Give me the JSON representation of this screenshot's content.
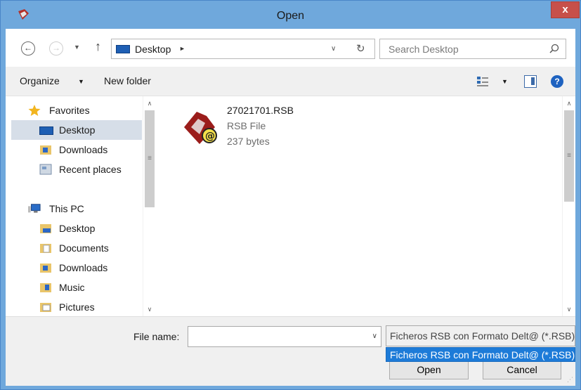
{
  "window": {
    "title": "Open",
    "close_label": "x"
  },
  "nav": {
    "back_glyph": "←",
    "forward_glyph": "→",
    "history_glyph": "▼",
    "up_glyph": "↑",
    "address_location": "Desktop",
    "address_chevron": "►",
    "address_dropdown_glyph": "∨",
    "refresh_glyph": "↻",
    "search_placeholder": "Search Desktop"
  },
  "toolbar": {
    "organize_label": "Organize",
    "organize_arrow": "▼",
    "new_folder_label": "New folder",
    "view_arrow": "▼",
    "help_glyph": "?"
  },
  "sidebar": {
    "items": [
      {
        "label": "Favorites",
        "icon": "star-icon"
      },
      {
        "label": "Desktop",
        "icon": "desktop-folder-icon",
        "selected": true
      },
      {
        "label": "Downloads",
        "icon": "downloads-folder-icon"
      },
      {
        "label": "Recent places",
        "icon": "recent-places-icon"
      },
      {
        "label": "This PC",
        "icon": "computer-icon"
      },
      {
        "label": "Desktop",
        "icon": "desktop-folder-icon"
      },
      {
        "label": "Documents",
        "icon": "documents-folder-icon"
      },
      {
        "label": "Downloads",
        "icon": "downloads-folder-icon"
      },
      {
        "label": "Music",
        "icon": "music-folder-icon"
      },
      {
        "label": "Pictures",
        "icon": "pictures-folder-icon"
      }
    ],
    "scroll_up_glyph": "∧",
    "scroll_down_glyph": "∨",
    "thumb_grip": "≡"
  },
  "files": [
    {
      "name": "27021701.RSB",
      "type": "RSB File",
      "size": "237 bytes",
      "icon": "rsb-file-icon"
    }
  ],
  "bottom": {
    "file_name_label": "File name:",
    "file_name_value": "",
    "file_name_arrow": "∨",
    "filter_selected": "Ficheros RSB con Formato Delt@ (*.RSB)",
    "filter_option": "Ficheros RSB con Formato Delt@ (*.RSB)",
    "open_label": "Open",
    "cancel_label": "Cancel",
    "grip_glyph": "⋰"
  },
  "colors": {
    "title_bar": "#6fa8dc",
    "close_button": "#c7504a",
    "selection": "#1d7bd8",
    "nav_selected": "#d6dee8"
  }
}
